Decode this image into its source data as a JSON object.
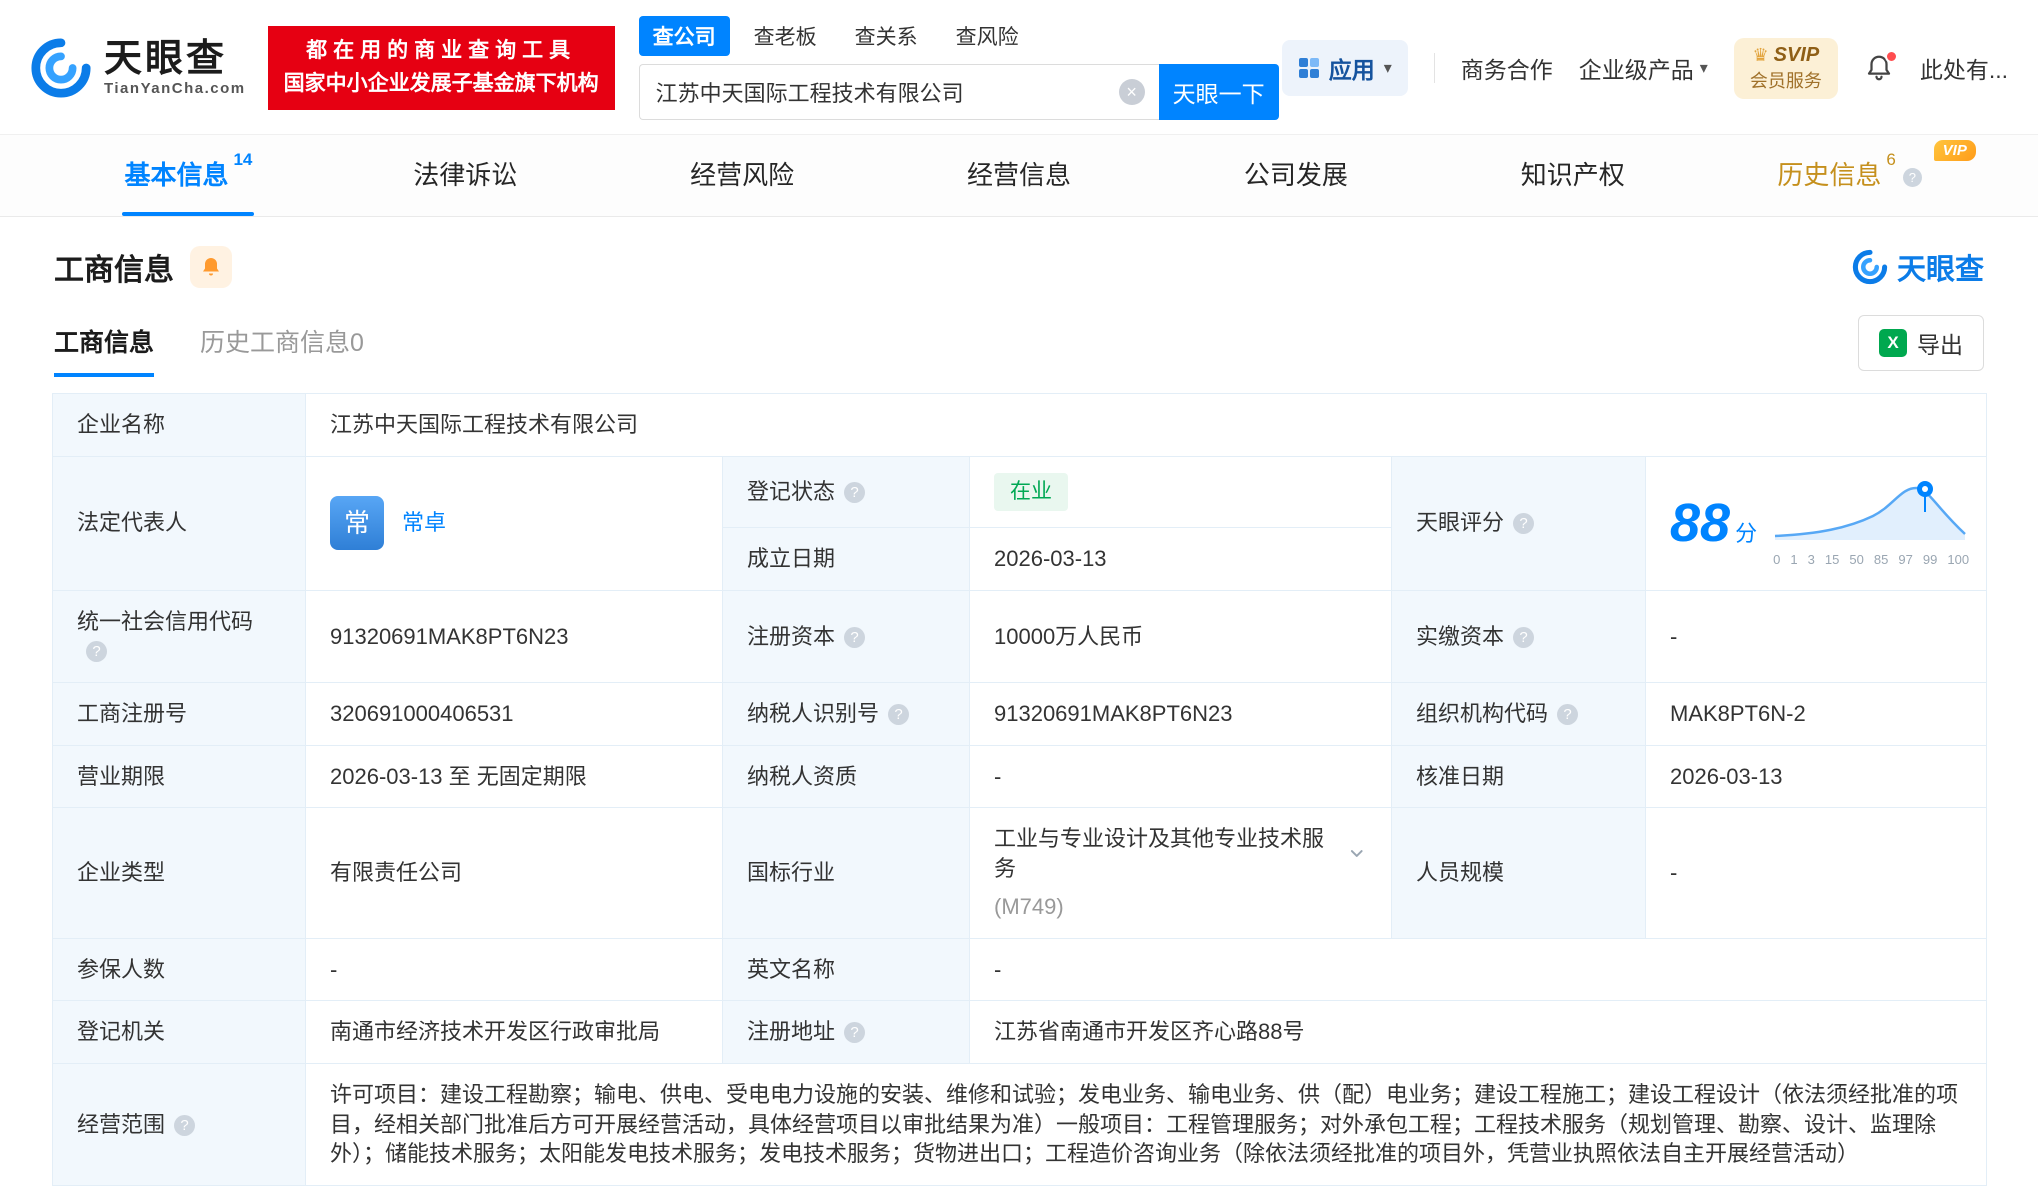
{
  "colors": {
    "primary": "#0084ff",
    "brand_red": "#e60012",
    "status_green": "#00a854",
    "vip_gold": "#c5901d"
  },
  "icons": {
    "help": "?",
    "clear": "×",
    "caret": "▾",
    "crown": "♛",
    "excel": "X"
  },
  "header": {
    "logo_cn": "天眼查",
    "logo_en": "TianYanCha.com",
    "promo_line1": "都在用的商业查询工具",
    "promo_line2": "国家中小企业发展子基金旗下机构",
    "search_tabs": [
      "查公司",
      "查老板",
      "查关系",
      "查风险"
    ],
    "search_value": "江苏中天国际工程技术有限公司",
    "search_button": "天眼一下",
    "apps": "应用",
    "cooperation": "商务合作",
    "enterprise": "企业级产品",
    "svip_top": "SVIP",
    "svip_bottom": "会员服务",
    "more": "此处有..."
  },
  "tabs": [
    {
      "label": "基本信息",
      "count": "14"
    },
    {
      "label": "法律诉讼",
      "count": ""
    },
    {
      "label": "经营风险",
      "count": ""
    },
    {
      "label": "经营信息",
      "count": ""
    },
    {
      "label": "公司发展",
      "count": ""
    },
    {
      "label": "知识产权",
      "count": ""
    },
    {
      "label": "历史信息",
      "count": "6",
      "vip": "VIP"
    }
  ],
  "section": {
    "title": "工商信息",
    "watermark": "天眼查",
    "subtabs": [
      "工商信息",
      "历史工商信息0"
    ],
    "export": "导出"
  },
  "score": {
    "label": "天眼评分",
    "value": "88",
    "unit": "分",
    "axis": [
      "0",
      "1",
      "3",
      "15",
      "50",
      "85",
      "97",
      "99",
      "100"
    ]
  },
  "fields": {
    "company_name": {
      "label": "企业名称",
      "value": "江苏中天国际工程技术有限公司"
    },
    "legal_rep": {
      "label": "法定代表人",
      "avatar": "常",
      "value": "常卓"
    },
    "reg_status": {
      "label": "登记状态",
      "value": "在业"
    },
    "est_date": {
      "label": "成立日期",
      "value": "2026-03-13"
    },
    "credit_code": {
      "label": "统一社会信用代码",
      "value": "91320691MAK8PT6N23"
    },
    "reg_capital": {
      "label": "注册资本",
      "value": "10000万人民币"
    },
    "paid_capital": {
      "label": "实缴资本",
      "value": "-"
    },
    "reg_no": {
      "label": "工商注册号",
      "value": "320691000406531"
    },
    "taxpayer_id": {
      "label": "纳税人识别号",
      "value": "91320691MAK8PT6N23"
    },
    "org_code": {
      "label": "组织机构代码",
      "value": "MAK8PT6N-2"
    },
    "term": {
      "label": "营业期限",
      "value": "2026-03-13 至 无固定期限"
    },
    "taxpayer_qual": {
      "label": "纳税人资质",
      "value": "-"
    },
    "approve_date": {
      "label": "核准日期",
      "value": "2026-03-13"
    },
    "company_type": {
      "label": "企业类型",
      "value": "有限责任公司"
    },
    "industry": {
      "label": "国标行业",
      "value": "工业与专业设计及其他专业技术服务",
      "code": "(M749)"
    },
    "staff_size": {
      "label": "人员规模",
      "value": "-"
    },
    "insured": {
      "label": "参保人数",
      "value": "-"
    },
    "eng_name": {
      "label": "英文名称",
      "value": "-"
    },
    "reg_org": {
      "label": "登记机关",
      "value": "南通市经济技术开发区行政审批局"
    },
    "address": {
      "label": "注册地址",
      "value": "江苏省南通市开发区齐心路88号"
    },
    "scope": {
      "label": "经营范围",
      "value": "许可项目：建设工程勘察；输电、供电、受电电力设施的安装、维修和试验；发电业务、输电业务、供（配）电业务；建设工程施工；建设工程设计（依法须经批准的项目，经相关部门批准后方可开展经营活动，具体经营项目以审批结果为准）一般项目：工程管理服务；对外承包工程；工程技术服务（规划管理、勘察、设计、监理除外）；储能技术服务；太阳能发电技术服务；发电技术服务；货物进出口；工程造价咨询业务（除依法须经批准的项目外，凭营业执照依法自主开展经营活动）"
    }
  }
}
